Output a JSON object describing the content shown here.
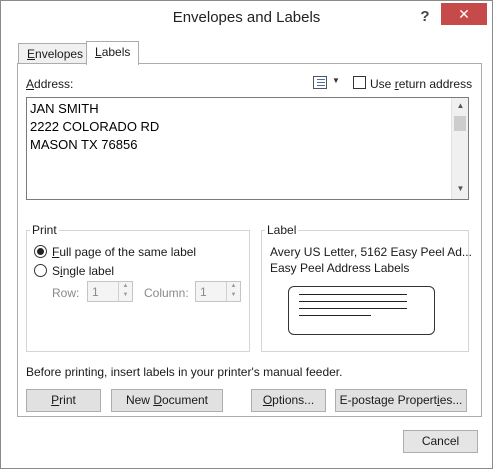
{
  "window": {
    "title": "Envelopes and Labels",
    "help_glyph": "?",
    "close_glyph": "✕"
  },
  "tabs": [
    {
      "label": "Envelopes",
      "mnemonic": "E",
      "rest": "nvelopes",
      "active": false
    },
    {
      "label": "Labels",
      "mnemonic": "L",
      "rest": "abels",
      "active": true
    }
  ],
  "address": {
    "label_mn": "A",
    "label_rest": "ddress:",
    "lines": [
      "JAN SMITH",
      "2222 COLORADO RD",
      "MASON TX  76856"
    ],
    "use_return_pre": "Use ",
    "use_return_mn": "r",
    "use_return_post": "eturn address",
    "use_return_checked": false,
    "address_book_icon": "address-book-icon"
  },
  "print_group": {
    "title": "Print",
    "full_page_mn": "F",
    "full_page_rest": "ull page of the same label",
    "full_page_selected": true,
    "single_pre": "S",
    "single_mn": "i",
    "single_post": "ngle label",
    "single_selected": false,
    "row_label": "Row:",
    "row_value": "1",
    "column_label": "Column:",
    "column_value": "1"
  },
  "label_group": {
    "title": "Label",
    "line1": "Avery US Letter, 5162 Easy Peel Ad...",
    "line2": "Easy Peel Address Labels"
  },
  "notice": "Before printing, insert labels in your printer's manual feeder.",
  "buttons": {
    "print_mn": "P",
    "print_rest": "rint",
    "new_doc_pre": "New ",
    "new_doc_mn": "D",
    "new_doc_post": "ocument",
    "options_pre": "",
    "options_mn": "O",
    "options_post": "ptions...",
    "epostage_pre": "E-postage Propert",
    "epostage_mn": "i",
    "epostage_post": "es...",
    "cancel": "Cancel"
  }
}
